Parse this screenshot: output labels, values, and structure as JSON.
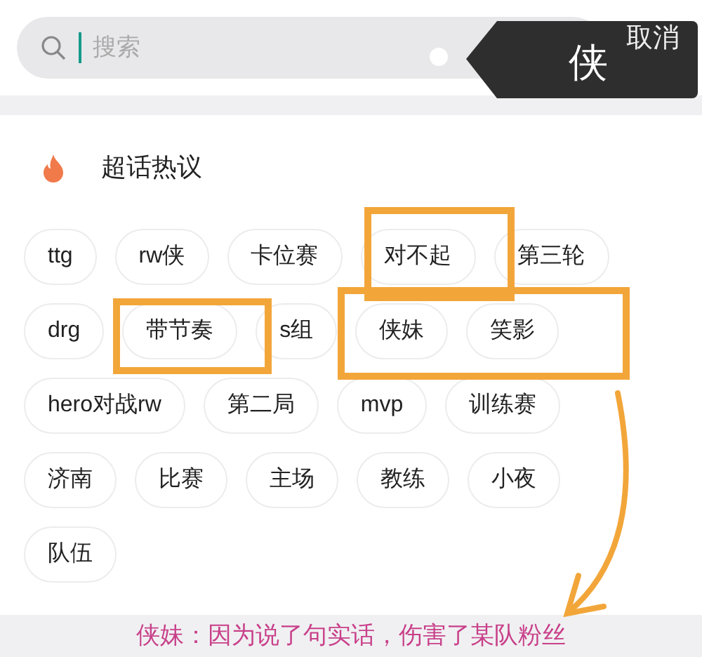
{
  "search": {
    "placeholder": "搜索",
    "focused": true
  },
  "key_preview": "侠",
  "cancel_button": "取消",
  "section": {
    "title": "超话热议"
  },
  "tags": [
    "ttg",
    "rw侠",
    "卡位赛",
    "对不起",
    "第三轮",
    "drg",
    "带节奏",
    "s组",
    "侠妹",
    "笑影",
    "hero对战rw",
    "第二局",
    "mvp",
    "训练赛",
    "济南",
    "比赛",
    "主场",
    "教练",
    "小夜",
    "队伍"
  ],
  "bottom_text": "侠妹：因为说了句实话，伤害了某队粉丝"
}
